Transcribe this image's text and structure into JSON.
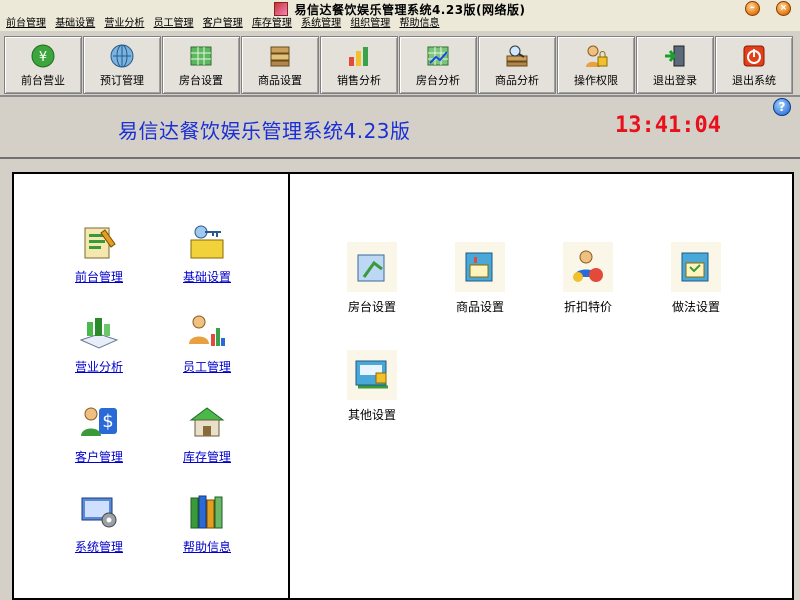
{
  "window": {
    "title": "易信达餐饮娱乐管理系统4.23版(网络版)"
  },
  "menu": [
    "前台管理",
    "基础设置",
    "营业分析",
    "员工管理",
    "客户管理",
    "库存管理",
    "系统管理",
    "组织管理",
    "帮助信息"
  ],
  "toolbar": [
    {
      "label": "前台营业",
      "icon": "money-icon"
    },
    {
      "label": "预订管理",
      "icon": "globe-icon"
    },
    {
      "label": "房台设置",
      "icon": "grid-icon"
    },
    {
      "label": "商品设置",
      "icon": "books-icon"
    },
    {
      "label": "销售分析",
      "icon": "bar-chart-icon"
    },
    {
      "label": "房台分析",
      "icon": "grid-chart-icon"
    },
    {
      "label": "商品分析",
      "icon": "book-search-icon"
    },
    {
      "label": "操作权限",
      "icon": "lock-user-icon"
    },
    {
      "label": "退出登录",
      "icon": "exit-door-icon"
    },
    {
      "label": "退出系统",
      "icon": "power-icon"
    }
  ],
  "header": {
    "system_name": "易信达餐饮娱乐管理系统4.23版",
    "clock": "13:41:04"
  },
  "left_nav": [
    {
      "label": "前台管理",
      "icon": "clipboard-icon"
    },
    {
      "label": "基础设置",
      "icon": "keys-icon"
    },
    {
      "label": "营业分析",
      "icon": "city-book-icon"
    },
    {
      "label": "员工管理",
      "icon": "users-chart-icon"
    },
    {
      "label": "客户管理",
      "icon": "customer-dollar-icon"
    },
    {
      "label": "库存管理",
      "icon": "warehouse-icon"
    },
    {
      "label": "系统管理",
      "icon": "monitor-tools-icon"
    },
    {
      "label": "帮助信息",
      "icon": "books-stack-icon"
    }
  ],
  "settings": [
    {
      "label": "房台设置",
      "icon": "table-setup-icon"
    },
    {
      "label": "商品设置",
      "icon": "product-setup-icon"
    },
    {
      "label": "折扣特价",
      "icon": "discount-user-icon"
    },
    {
      "label": "做法设置",
      "icon": "cooking-book-icon"
    },
    {
      "label": "其他设置",
      "icon": "other-settings-icon"
    }
  ]
}
